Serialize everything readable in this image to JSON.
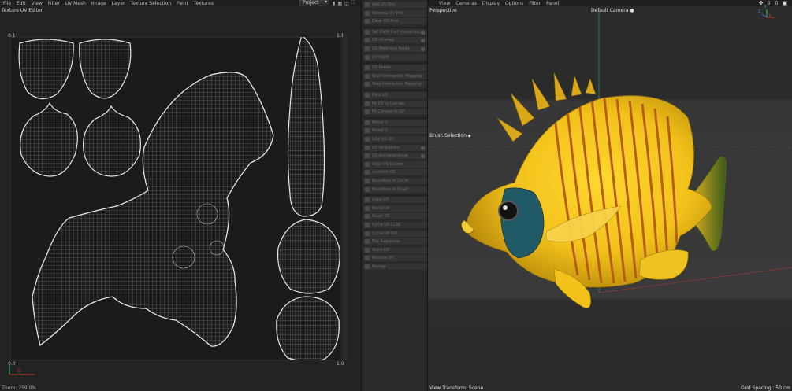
{
  "uv_editor": {
    "menu": [
      "File",
      "Edit",
      "View",
      "Filter",
      "UV Mesh",
      "Image",
      "Layer",
      "Texture Selection",
      "Paint",
      "Textures"
    ],
    "project_select": "Project",
    "title": "Texture UV Editor",
    "coords": {
      "top_left": "0,1",
      "top_right": "1,1",
      "bottom_left": "0,0",
      "bottom_right": "1,0"
    },
    "axis_u": "U",
    "axis_v": "V",
    "zoom": "Zoom: 259.0%"
  },
  "uv_commands": {
    "items": [
      {
        "label": "Add UV Pins",
        "icon": "pin-icon",
        "gear": false
      },
      {
        "label": "Remove UV Pins",
        "icon": "pin-icon",
        "gear": false
      },
      {
        "label": "Clear UV Pins",
        "icon": "pin-icon",
        "gear": false
      },
      {
        "label": "Set UVW from Projection",
        "icon": "projection-icon",
        "gear": true
      },
      {
        "label": "UV Unwrap",
        "icon": "unwrap-icon",
        "gear": true
      },
      {
        "label": "UV Weld and Relax",
        "icon": "weld-icon",
        "gear": true
      },
      {
        "label": "UV Weld",
        "icon": "weld-icon",
        "gear": false
      },
      {
        "label": "UV Peeler",
        "icon": "peeler-icon",
        "gear": false
      },
      {
        "label": "Start Interactive Mapping",
        "icon": "mapping-icon",
        "gear": false
      },
      {
        "label": "Stop Interactive Mapping",
        "icon": "mapping-icon",
        "gear": false
      },
      {
        "label": "Pack UV",
        "icon": "pack-icon",
        "gear": false
      },
      {
        "label": "Fit UV to Canvas",
        "icon": "fit-icon",
        "gear": false
      },
      {
        "label": "Fit Canvas to UV",
        "icon": "fit-icon",
        "gear": false
      },
      {
        "label": "Mirror U",
        "icon": "mirror-icon",
        "gear": false
      },
      {
        "label": "Mirror V",
        "icon": "mirror-icon",
        "gear": false
      },
      {
        "label": "Line Up UV",
        "icon": "lineup-icon",
        "gear": false
      },
      {
        "label": "UV Straighten",
        "icon": "straighten-icon",
        "gear": true
      },
      {
        "label": "UV Rectangularize",
        "icon": "rectangle-icon",
        "gear": true
      },
      {
        "label": "Align UV Islands",
        "icon": "align-icon",
        "gear": false
      },
      {
        "label": "Unstitch UV",
        "icon": "unstitch-icon",
        "gear": false
      },
      {
        "label": "Boundary to Circle",
        "icon": "circle-icon",
        "gear": false
      },
      {
        "label": "Boundary to Quad",
        "icon": "quad-icon",
        "gear": false
      },
      {
        "label": "Copy UV",
        "icon": "copy-icon",
        "gear": false
      },
      {
        "label": "Paste UV",
        "icon": "paste-icon",
        "gear": false
      },
      {
        "label": "Reset UV",
        "icon": "reset-icon",
        "gear": false
      },
      {
        "label": "Cycle UV CCW",
        "icon": "cycle-icon",
        "gear": false
      },
      {
        "label": "Cycle UV CW",
        "icon": "cycle-icon",
        "gear": false
      },
      {
        "label": "Flip Sequence",
        "icon": "flip-icon",
        "gear": false
      },
      {
        "label": "Store UV",
        "icon": "store-icon",
        "gear": false
      },
      {
        "label": "Restore UV",
        "icon": "restore-icon",
        "gear": false
      },
      {
        "label": "Remap...",
        "icon": "remap-icon",
        "gear": false
      }
    ]
  },
  "viewport": {
    "menu": [
      "View",
      "Cameras",
      "Display",
      "Options",
      "Filter",
      "Panel"
    ],
    "mode": "Perspective",
    "camera": "Default Camera",
    "camera_icon": "camera-icon",
    "tool": "Brush Selection",
    "view_transform": "View Transform: Scene",
    "grid_spacing": "Grid Spacing : 50 cm",
    "nav_icons": [
      "move-view-icon",
      "down-arrow-icon",
      "zoom-icon",
      "maximize-icon"
    ],
    "axis_labels": {
      "y": "Y",
      "x": "X",
      "z": "Z"
    }
  },
  "colors": {
    "fish_yellow": "#f2c21a",
    "fish_stripe": "#b86a18",
    "fish_mask": "#1f5a66",
    "wire": "#d8d8d8",
    "u_axis": "#c0392b",
    "v_axis": "#2ecc71"
  }
}
